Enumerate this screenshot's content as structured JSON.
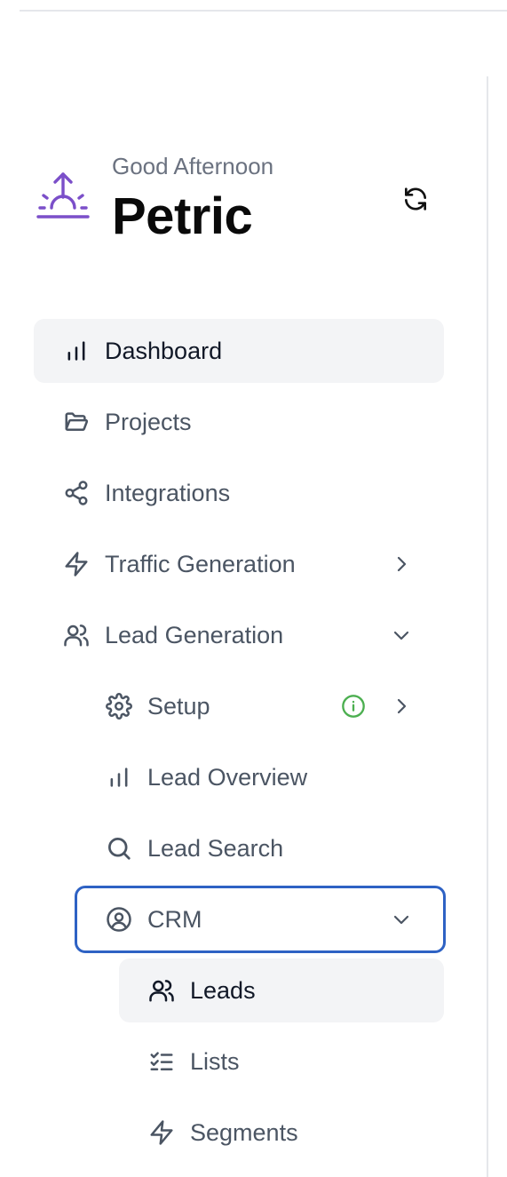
{
  "header": {
    "greeting": "Good Afternoon",
    "user_name": "Petric",
    "logo_icon": "sunrise-icon",
    "refresh_icon": "refresh-icon"
  },
  "nav": {
    "items": [
      {
        "label": "Dashboard",
        "icon": "bar-chart-icon",
        "state": "active"
      },
      {
        "label": "Projects",
        "icon": "folder-open-icon"
      },
      {
        "label": "Integrations",
        "icon": "share-icon"
      },
      {
        "label": "Traffic Generation",
        "icon": "lightning-icon",
        "chevron": "chevron-right-icon"
      },
      {
        "label": "Lead Generation",
        "icon": "users-icon",
        "chevron": "chevron-down-icon"
      },
      {
        "label": "Setup",
        "icon": "gear-icon",
        "chevron": "chevron-right-icon",
        "badge": "info-icon"
      },
      {
        "label": "Lead Overview",
        "icon": "bar-chart-icon"
      },
      {
        "label": "Lead Search",
        "icon": "search-icon"
      },
      {
        "label": "CRM",
        "icon": "user-circle-icon",
        "chevron": "chevron-down-icon",
        "state": "focused"
      },
      {
        "label": "Leads",
        "icon": "users-icon",
        "state": "active"
      },
      {
        "label": "Lists",
        "icon": "checklist-icon"
      },
      {
        "label": "Segments",
        "icon": "lightning-icon"
      }
    ]
  },
  "colors": {
    "brand": "#7b4fc9",
    "focus_ring": "#2e62c4",
    "active_bg": "#f3f4f6",
    "info_green": "#4caf50",
    "text_muted": "#4b5563"
  }
}
